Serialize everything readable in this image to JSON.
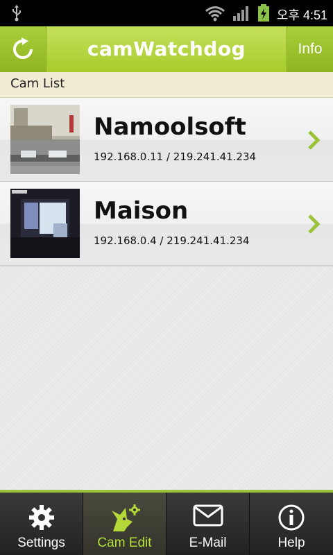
{
  "status_bar": {
    "time": "오후 4:51",
    "icons": [
      "usb-icon",
      "wifi-icon",
      "signal-icon",
      "battery-charging-icon"
    ]
  },
  "header": {
    "title": "camWatchdog",
    "refresh_icon": "refresh-icon",
    "info_label": "Info"
  },
  "section": {
    "title": "Cam List"
  },
  "cams": [
    {
      "name": "Namoolsoft",
      "address": "192.168.0.11 / 219.241.41.234"
    },
    {
      "name": "Maison",
      "address": "192.168.0.4 / 219.241.41.234"
    }
  ],
  "tabs": [
    {
      "label": "Settings",
      "icon": "gear-icon"
    },
    {
      "label": "Cam Edit",
      "icon": "dog-gear-icon"
    },
    {
      "label": "E-Mail",
      "icon": "envelope-icon"
    },
    {
      "label": "Help",
      "icon": "info-icon"
    }
  ],
  "colors": {
    "accent": "#a8cc2c",
    "active_tab_label": "#b4e03a",
    "status_bar": "#000000"
  }
}
